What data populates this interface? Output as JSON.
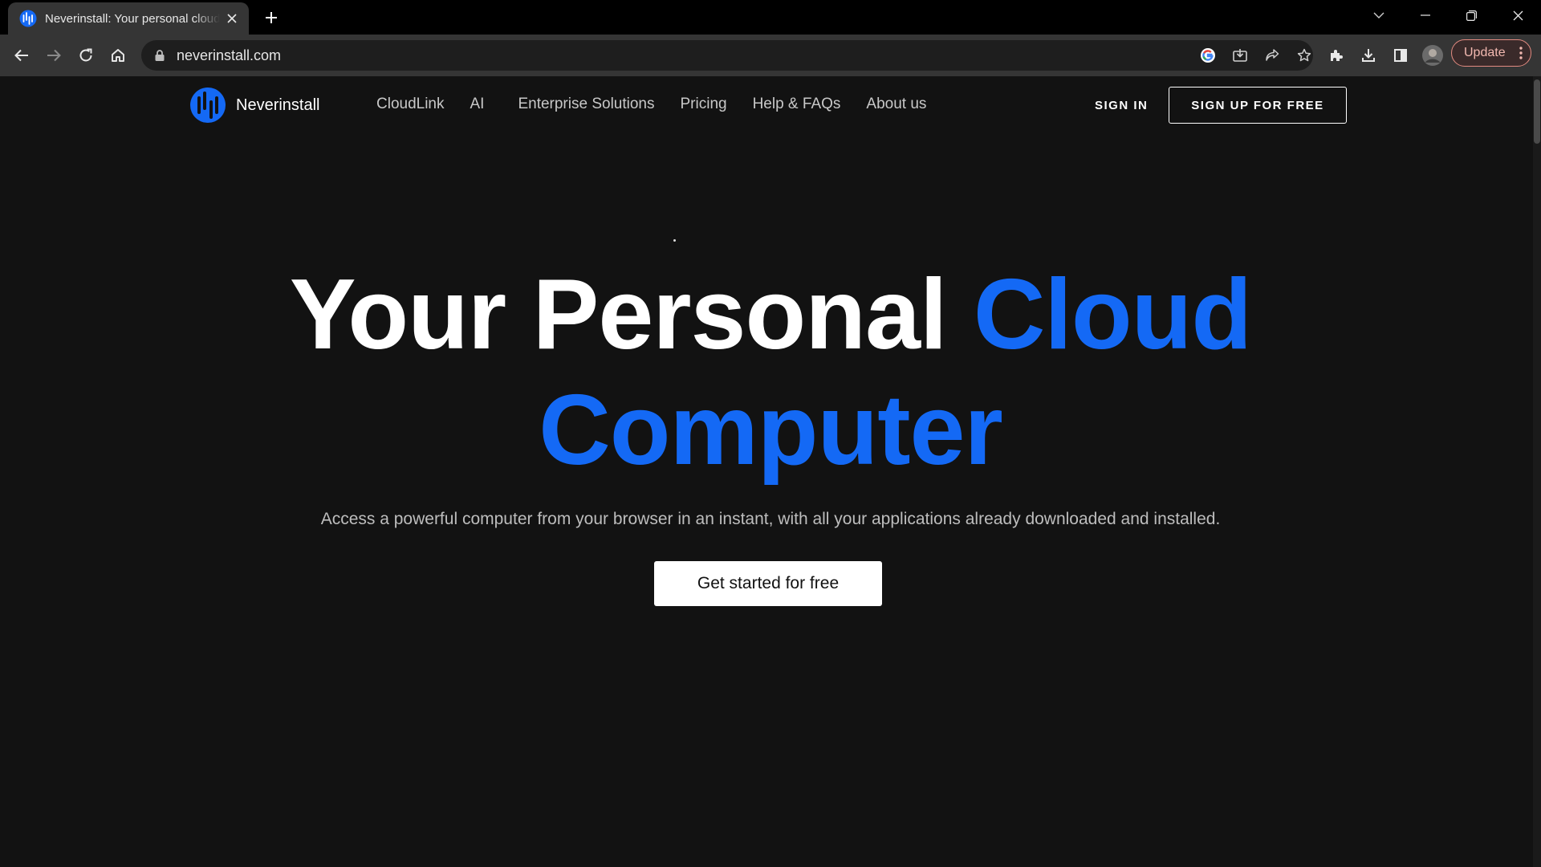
{
  "browser": {
    "tab_title": "Neverinstall: Your personal cloud computer",
    "url": "neverinstall.com",
    "update_label": "Update",
    "icons": {
      "favicon": "neverinstall-logo-icon",
      "close": "close-icon",
      "new_tab": "plus-icon",
      "tab_search": "chevron-down-icon",
      "minimize": "minimize-icon",
      "restore": "restore-icon",
      "window_close": "close-icon",
      "back": "arrow-left-icon",
      "forward": "arrow-right-icon",
      "reload": "reload-icon",
      "home": "home-icon",
      "lock": "lock-icon",
      "google": "google-icon",
      "install": "install-icon",
      "share": "share-icon",
      "bookmark": "star-icon",
      "extensions": "puzzle-icon",
      "downloads": "download-icon",
      "side_panel": "side-panel-icon",
      "profile": "avatar",
      "menu": "more-vertical-icon"
    }
  },
  "nav": {
    "brand": "Neverinstall",
    "links": [
      "CloudLink",
      "AI",
      "Enterprise Solutions",
      "Pricing",
      "Help & FAQs",
      "About us"
    ],
    "sign_in": "SIGN IN",
    "sign_up": "SIGN UP FOR FREE"
  },
  "hero": {
    "title_white": "Your Personal",
    "title_blue_1": "Cloud",
    "title_blue_2": "Computer",
    "subtitle": "Access a powerful computer from your browser in an instant, with all your applications already downloaded and installed.",
    "cta": "Get started for free"
  },
  "colors": {
    "accent_blue": "#1469f5",
    "page_bg": "#121212",
    "chrome_bg": "#353535",
    "tabstrip_bg": "#000000"
  }
}
